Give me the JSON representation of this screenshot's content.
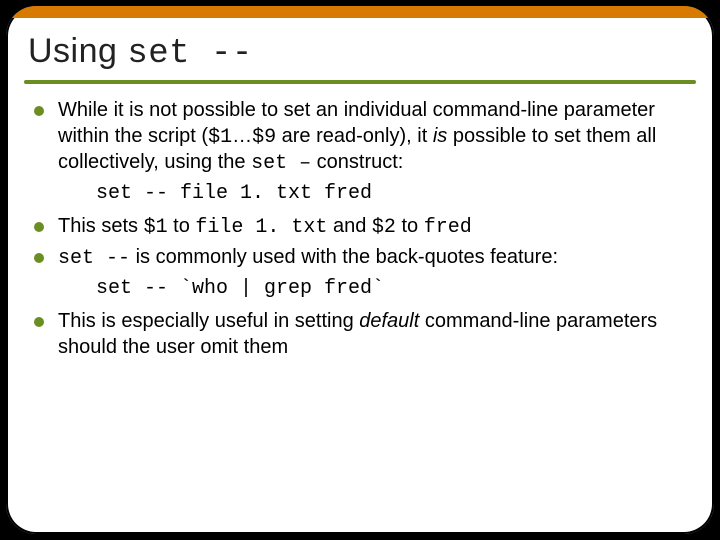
{
  "title": {
    "prefix": "Using ",
    "mono": "set --"
  },
  "bullets": {
    "b1": {
      "t1": "While it is not possible to set an individual command-line parameter within the script (",
      "m1": "$1",
      "t2": "…",
      "m2": "$9",
      "t3": " are read-only), it ",
      "is": "is",
      "t4": " possible to set them all collectively, using the ",
      "m3": "set –",
      "t5": " construct:"
    },
    "code1": "set -- file 1. txt fred",
    "b2": {
      "t1": "This sets ",
      "m1": "$1",
      "t2": " to ",
      "m2": "file 1. txt",
      "t3": " and ",
      "m3": "$2",
      "t4": " to ",
      "m4": "fred"
    },
    "b3": {
      "m1": "set --",
      "t1": " is commonly used with the back-quotes feature:"
    },
    "code2": "set -- `who | grep fred`",
    "b4": {
      "t1": "This is especially useful in setting ",
      "default": "default",
      "t2": " command-line parameters should the user omit them"
    }
  }
}
